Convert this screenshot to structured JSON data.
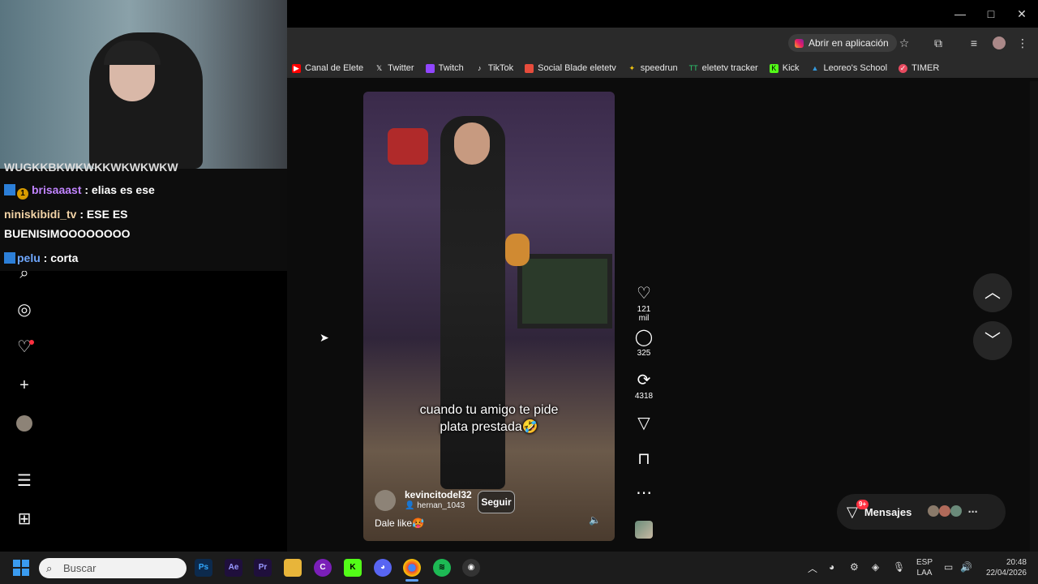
{
  "browser": {
    "open_in_app": "Abrir en aplicación",
    "window_controls": [
      "—",
      "□",
      "✕"
    ],
    "bookmarks": [
      {
        "label": "Canal de Elete",
        "icon": "youtube-icon",
        "color": "#ff0000"
      },
      {
        "label": "Twitter",
        "icon": "x-icon",
        "color": "#ffffff"
      },
      {
        "label": "Twitch",
        "icon": "twitch-icon",
        "color": "#9146ff"
      },
      {
        "label": "TikTok",
        "icon": "tiktok-icon",
        "color": "#ffffff"
      },
      {
        "label": "Social Blade eletetv",
        "icon": "socialblade-icon",
        "color": "#e74c3c"
      },
      {
        "label": "speedrun",
        "icon": "speedrun-icon",
        "color": "#f1c40f"
      },
      {
        "label": "eletetv tracker",
        "icon": "tracker-icon",
        "color": "#2ecc71"
      },
      {
        "label": "Kick",
        "icon": "kick-icon",
        "color": "#53fc18"
      },
      {
        "label": "Leoreo's School",
        "icon": "school-icon",
        "color": "#3498db"
      },
      {
        "label": "TIMER",
        "icon": "timer-icon",
        "color": "#e84a5f"
      }
    ]
  },
  "chat": {
    "partial_top": "WUGKKBKWKWKKWKWKWKW",
    "messages": [
      {
        "user": "brisaaast",
        "text": ": elias es ese",
        "user_color": "#c184ff"
      },
      {
        "user": "niniskibidi_tv",
        "text": ": ESE ES",
        "user_color": "#f2d3a6"
      },
      {
        "user": "",
        "text": "BUENISIMOOOOOOOO",
        "user_color": "#ffffff"
      },
      {
        "user": "pelu",
        "text": ": corta",
        "user_color": "#6fa8ff"
      }
    ],
    "badge_number": "1"
  },
  "video": {
    "caption_line1": "cuando tu amigo te pide",
    "caption_line2": "plata prestada🤣",
    "username": "kevincitodel32",
    "sub_username": "hernan_1043",
    "follow_label": "Seguir",
    "description": "Dale like🥵"
  },
  "actions": {
    "likes": "121 mil",
    "comments": "325",
    "reposts": "4318"
  },
  "messages": {
    "label": "Mensajes",
    "badge": "9+"
  },
  "taskbar": {
    "search_placeholder": "Buscar",
    "lang_top": "ESP",
    "lang_bottom": "LAA",
    "time": "20:48",
    "date": "22/04/2026"
  }
}
